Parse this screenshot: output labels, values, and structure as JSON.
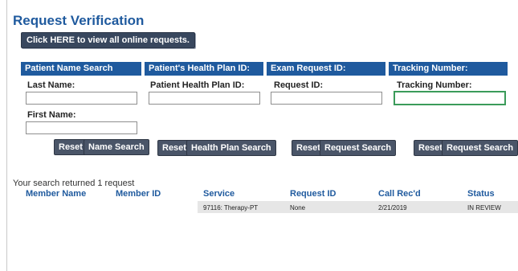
{
  "page": {
    "title": "Request Verification",
    "view_all_button": "Click HERE to view all online requests."
  },
  "search": {
    "patient_name": {
      "header": "Patient Name Search",
      "last_name_label": "Last Name:",
      "first_name_label": "First Name:",
      "reset": "Reset",
      "search": "Name Search"
    },
    "health_plan": {
      "header": "Patient's Health Plan ID:",
      "field_label": "Patient Health Plan ID:",
      "reset": "Reset",
      "search": "Health Plan Search"
    },
    "exam_request": {
      "header": "Exam Request ID:",
      "field_label": "Request ID:",
      "reset": "Reset",
      "search": "Request Search"
    },
    "tracking": {
      "header": "Tracking Number:",
      "field_label": "Tracking Number:",
      "reset": "Reset",
      "search": "Request Search"
    }
  },
  "results": {
    "summary": "Your search returned 1 request",
    "columns": [
      "Member Name",
      "Member ID",
      "Service",
      "Request ID",
      "Call Rec'd",
      "Status"
    ],
    "rows": [
      {
        "member_name": "",
        "member_id": "",
        "service": "97116: Therapy-PT",
        "request_id": "None",
        "call_recd": "2/21/2019",
        "status": "IN REVIEW"
      }
    ]
  },
  "colors": {
    "header_blue": "#1f5a9e",
    "button_dark": "#4a5568",
    "active_border": "#3b9b5a"
  }
}
